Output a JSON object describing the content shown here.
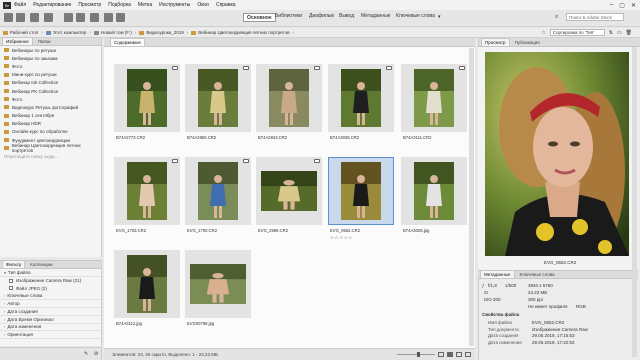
{
  "menu": {
    "logo": "Br",
    "items": [
      "Файл",
      "Редактирование",
      "Просмотр",
      "Подборка",
      "Метка",
      "Инструменты",
      "Окно",
      "Справка"
    ]
  },
  "workspaces": {
    "tabs": [
      "Основное",
      "Библиотеки",
      "Диафильм",
      "Вывод",
      "Метаданные",
      "Ключевые слова"
    ],
    "active": "Основное"
  },
  "search": {
    "placeholder": "Поиск в Adobe Stock"
  },
  "breadcrumbs": [
    "Рабочий стол",
    "Этот компьютер",
    "Новый том (F:)",
    "Видеоуроки_2019",
    "Вебинар Цветокоррекция летних портретов"
  ],
  "sort": {
    "label": "Сортировка по 'Тип'"
  },
  "left_panel": {
    "tabs": [
      "Избранное",
      "Папки"
    ],
    "favorites": [
      "Вебинары по ретуши",
      "Вебинары по заказам",
      "Фото",
      "Мини-курс по ретуши",
      "Вебинар Ink Collection",
      "Вебинар PK Collection",
      "Фото",
      "Видеокурс Ретушь фотографий",
      "Вебинар 1 сентября",
      "Вебинар HDR",
      "Онлайн-курс по обработке",
      "Фундамент цветокоррекции",
      "Вебинар Цветокоррекция летних портретов"
    ],
    "drop_hint": "Перетащите папку сюда..."
  },
  "filter_panel": {
    "tabs": [
      "Фильтр",
      "Коллекции"
    ],
    "sections": [
      {
        "title": "Тип файла",
        "items": [
          {
            "label": "Изображение Camera Raw",
            "count": "(21)"
          },
          {
            "label": "Файл JPEG",
            "count": "(2)"
          }
        ]
      },
      {
        "title": "Ключевые слова",
        "items": []
      },
      {
        "title": "Автор",
        "items": []
      },
      {
        "title": "Дата создания",
        "items": []
      },
      {
        "title": "Дата Время Оригинал",
        "items": []
      },
      {
        "title": "Дата изменения",
        "items": []
      },
      {
        "title": "Ориентация",
        "items": []
      }
    ]
  },
  "content": {
    "tab": "Содержимое",
    "thumbnails": [
      {
        "name": "B74A2773.CR2",
        "selected": false,
        "stars": ""
      },
      {
        "name": "B74A2806.CR2",
        "selected": false,
        "stars": ""
      },
      {
        "name": "B74A2843.CR2",
        "selected": false,
        "stars": ""
      },
      {
        "name": "B74A3036.CR2",
        "selected": false,
        "stars": ""
      },
      {
        "name": "B74A3111.CR2",
        "selected": false,
        "stars": ""
      },
      {
        "name": "EVG_1703.CR2",
        "selected": false,
        "stars": ""
      },
      {
        "name": "EVG_1700.CR2",
        "selected": false,
        "stars": ""
      },
      {
        "name": "EVG_2989.CR2",
        "selected": false,
        "stars": ""
      },
      {
        "name": "EVG_0652.CR2",
        "selected": true,
        "stars": "☆☆☆☆☆"
      },
      {
        "name": "B74A3028.jpg",
        "selected": false,
        "stars": ""
      },
      {
        "name": "B74A3112.jpg",
        "selected": false,
        "stars": ""
      },
      {
        "name": "EVG00798.jpg",
        "selected": false,
        "stars": ""
      }
    ]
  },
  "status": {
    "text": "Элементов: 23, 26 скрыто, Выделено: 1 - 24,23 МБ"
  },
  "right_panel": {
    "tabs": [
      "Просмотр",
      "Публикация"
    ],
    "preview_name": "EVG_0652.CR2",
    "meta_tabs": [
      "Метаданные",
      "Ключевые слова"
    ],
    "camera": {
      "fstop": "f/1,8",
      "shutter": "1/500",
      "size": "3840 x 5760",
      "filesize": "24.23 МБ",
      "iso_label": "ISO 200",
      "dpi": "300 ppi",
      "colorspace": "Не имеет профиля",
      "mode": "RGB"
    },
    "file_props_title": "Свойства файла",
    "file_props": [
      {
        "k": "Имя файла",
        "v": "EVG_0652.CR2"
      },
      {
        "k": "Тип документа",
        "v": "Изображение Camera Raw"
      },
      {
        "k": "Дата создания",
        "v": "29.05.2019, 17:15:53"
      },
      {
        "k": "Дата изменения",
        "v": "29.05.2019, 17:22:53"
      }
    ]
  },
  "colors": {
    "accent": "#5b8fd1",
    "folder": "#c99b39"
  }
}
